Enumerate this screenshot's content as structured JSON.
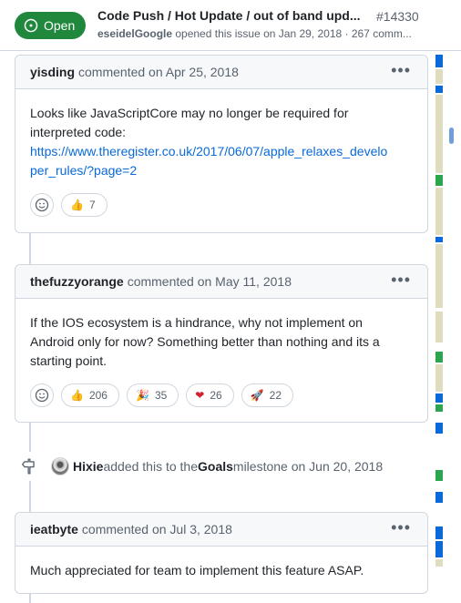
{
  "header": {
    "state": "Open",
    "title": "Code Push / Hot Update / out of band upd...",
    "number": "#14330",
    "author": "eseidelGoogle",
    "meta_text": " opened this issue on Jan 29, 2018 · 267 comm..."
  },
  "comments": [
    {
      "author": "yisding",
      "date_text": "commented on Apr 25, 2018",
      "body_line1": "Looks like JavaScriptCore may no longer be required for",
      "body_line2": "interpreted code:",
      "link_line1": "https://www.theregister.co.uk/2017/06/07/apple_relaxes_develo",
      "link_line2": "per_rules/?page=2",
      "reactions": [
        {
          "icon": "thumbs-up",
          "emoji": "👍",
          "count": "7"
        }
      ]
    },
    {
      "author": "thefuzzyorange",
      "date_text": "commented on May 11, 2018",
      "body_line1": "If the IOS ecosystem is a hindrance, why not implement on",
      "body_line2": "Android only for now? Something better than nothing and its a",
      "body_line3": "starting point.",
      "reactions": [
        {
          "icon": "thumbs-up",
          "emoji": "👍",
          "count": "206"
        },
        {
          "icon": "hooray",
          "emoji": "🎉",
          "count": "35"
        },
        {
          "icon": "heart",
          "emoji": "❤",
          "count": "26"
        },
        {
          "icon": "rocket",
          "emoji": "🚀",
          "count": "22"
        }
      ]
    },
    {
      "author": "ieatbyte",
      "date_text": "commented on Jul 3, 2018",
      "body_line1": "Much appreciated for team to implement this feature ASAP."
    }
  ],
  "event": {
    "actor": "Hixie",
    "action": " added this to the ",
    "milestone": "Goals",
    "suffix": " milestone on Jun 20, 2018"
  },
  "colors": {
    "open_green": "#1f883d",
    "link_blue": "#0969da",
    "minimap_blue": "#0969da",
    "minimap_green": "#2da44e",
    "minimap_tan": "#e0dcc0"
  }
}
